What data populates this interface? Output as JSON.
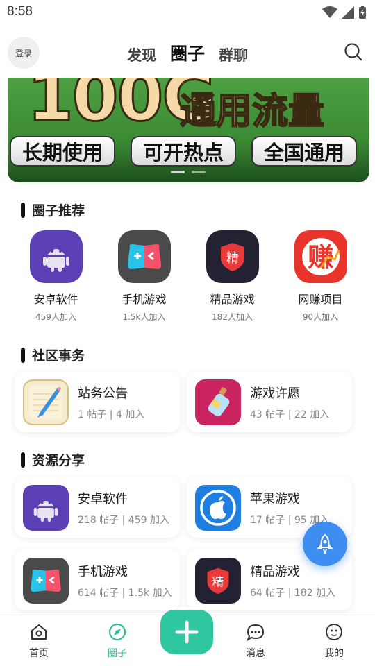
{
  "status": {
    "time": "8:58"
  },
  "header": {
    "login_label": "登录",
    "tabs": [
      {
        "label": "发现",
        "active": false
      },
      {
        "label": "圈子",
        "active": true
      },
      {
        "label": "群聊",
        "active": false
      }
    ]
  },
  "banner": {
    "headline": "100G",
    "headline_suffix": "通用流量",
    "pills": [
      "长期使用",
      "可开热点",
      "全国通用"
    ],
    "page_dots": 2
  },
  "sections": {
    "recommend_title": "圈子推荐",
    "community_title": "社区事务",
    "resources_title": "资源分享"
  },
  "recommend": [
    {
      "name": "安卓软件",
      "count": "459人加入",
      "icon": "android-icon",
      "color": "#5b3fb5"
    },
    {
      "name": "手机游戏",
      "count": "1.5k人加入",
      "icon": "gamepad-icon",
      "color": "#4a4a4a"
    },
    {
      "name": "精品游戏",
      "count": "182人加入",
      "icon": "premium-game-icon",
      "color": "#222233"
    },
    {
      "name": "网赚项目",
      "count": "90人加入",
      "icon": "earn-icon",
      "color": "#e8342b"
    }
  ],
  "community": [
    {
      "title": "站务公告",
      "meta": "1 帖子 | 4 加入",
      "icon": "notepad-icon"
    },
    {
      "title": "游戏许愿",
      "meta": "43 帖子 | 22 加入",
      "icon": "wish-bottle-icon"
    }
  ],
  "resources": [
    {
      "title": "安卓软件",
      "meta": "218 帖子 | 459 加入",
      "icon": "android-icon"
    },
    {
      "title": "苹果游戏",
      "meta": "17 帖子 | 95 加入",
      "icon": "apple-icon"
    },
    {
      "title": "手机游戏",
      "meta": "614 帖子 | 1.5k 加入",
      "icon": "gamepad-icon"
    },
    {
      "title": "精品游戏",
      "meta": "64 帖子 | 182 加入",
      "icon": "premium-game-icon"
    }
  ],
  "premium_badge": "精",
  "earn_badge": "赚",
  "bottom_nav": [
    {
      "label": "首页",
      "icon": "home-icon",
      "active": false
    },
    {
      "label": "圈子",
      "icon": "compass-icon",
      "active": true
    },
    {
      "label": "消息",
      "icon": "message-icon",
      "active": false
    },
    {
      "label": "我的",
      "icon": "profile-icon",
      "active": false
    }
  ],
  "colors": {
    "accent": "#2fc7a0",
    "rocket": "#3d8ef0"
  }
}
